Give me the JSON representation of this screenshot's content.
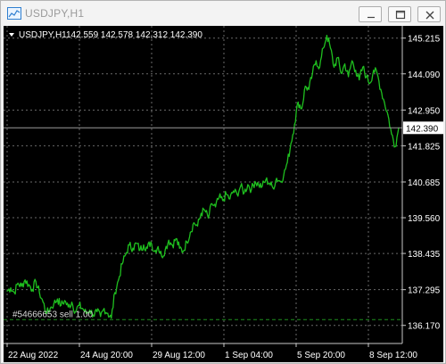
{
  "window": {
    "title": "USDJPY,H1"
  },
  "chart_header": {
    "symbol_tf": "USDJPY,H1",
    "ohlc": "142.559 142.578 142.312 142.390"
  },
  "order_label": "#54666653 sell 1.00",
  "colors": {
    "background": "#000000",
    "grid": "#6a6a6a",
    "line": "#1fbf1f",
    "text": "#ffffff",
    "order_line": "#1f8f1f"
  },
  "chart_data": {
    "type": "line",
    "title": "",
    "xlabel": "",
    "ylabel": "",
    "ylim": [
      135.6,
      145.6
    ],
    "y_ticks": [
      {
        "value": 145.215,
        "label": "145.215"
      },
      {
        "value": 144.09,
        "label": "144.090"
      },
      {
        "value": 142.95,
        "label": "142.950"
      },
      {
        "value": 141.825,
        "label": "141.825"
      },
      {
        "value": 140.685,
        "label": "140.685"
      },
      {
        "value": 139.56,
        "label": "139.560"
      },
      {
        "value": 138.435,
        "label": "138.435"
      },
      {
        "value": 137.295,
        "label": "137.295"
      },
      {
        "value": 136.17,
        "label": "136.170"
      }
    ],
    "x_ticks": [
      "22 Aug 2022",
      "24 Aug 20:00",
      "29 Aug 12:00",
      "1 Sep 04:00",
      "5 Sep 20:00",
      "8 Sep 12:00"
    ],
    "current_price": 142.39,
    "order_price": 136.35,
    "series": [
      {
        "values": [
          137.25,
          137.35,
          137.2,
          137.5,
          137.4,
          137.6,
          137.45,
          137.3,
          137.55,
          137.2,
          136.9,
          136.55,
          136.7,
          136.85,
          137.0,
          136.8,
          136.95,
          136.75,
          136.9,
          136.6,
          136.8,
          136.7,
          136.55,
          136.65,
          136.5,
          136.6,
          136.45,
          136.7,
          136.55,
          136.4,
          137.2,
          137.6,
          138.1,
          138.4,
          138.7,
          138.6,
          138.75,
          138.55,
          138.7,
          138.6,
          138.8,
          138.5,
          138.65,
          138.35,
          138.55,
          138.85,
          138.7,
          138.9,
          138.6,
          138.5,
          138.8,
          139.1,
          139.4,
          139.3,
          139.7,
          139.8,
          139.55,
          140.0,
          139.9,
          140.2,
          140.1,
          140.3,
          140.15,
          140.4,
          140.3,
          140.55,
          140.35,
          140.6,
          140.45,
          140.7,
          140.6,
          140.55,
          140.75,
          140.65,
          140.5,
          140.8,
          140.7,
          140.9,
          141.3,
          141.9,
          142.5,
          143.2,
          143.0,
          143.7,
          143.6,
          144.1,
          144.5,
          144.3,
          144.9,
          145.3,
          144.9,
          144.3,
          144.6,
          144.1,
          144.4,
          144.0,
          144.5,
          144.2,
          143.9,
          144.3,
          144.0,
          143.8,
          144.2,
          144.1,
          143.6,
          143.2,
          142.8,
          142.2,
          141.8,
          142.39
        ]
      }
    ]
  }
}
